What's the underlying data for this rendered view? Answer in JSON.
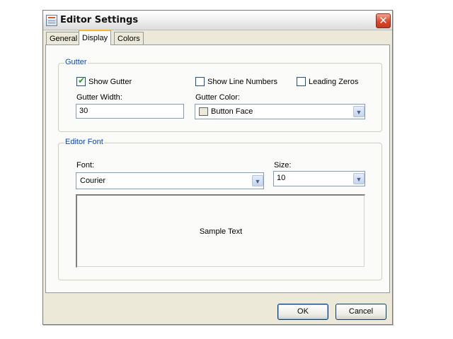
{
  "window": {
    "title": "Editor Settings",
    "close_glyph": "✕",
    "icon": "app-window-icon"
  },
  "tabs": [
    {
      "label": "General",
      "active": false
    },
    {
      "label": "Display",
      "active": true
    },
    {
      "label": "Colors",
      "active": false
    }
  ],
  "gutter": {
    "legend": "Gutter",
    "show_gutter": {
      "label": "Show Gutter",
      "checked": true
    },
    "show_line_numbers": {
      "label": "Show Line Numbers",
      "checked": false
    },
    "leading_zeros": {
      "label": "Leading Zeros",
      "checked": false
    },
    "width_label": "Gutter Width:",
    "width_value": "30",
    "color_label": "Gutter Color:",
    "color_value": "Button Face",
    "color_swatch": "#ece9d8"
  },
  "editor_font": {
    "legend": "Editor Font",
    "font_label": "Font:",
    "font_value": "Courier",
    "size_label": "Size:",
    "size_value": "10",
    "sample_text": "Sample Text"
  },
  "buttons": {
    "ok": "OK",
    "cancel": "Cancel"
  },
  "glyphs": {
    "check": "✔",
    "dropdown": "▼"
  }
}
